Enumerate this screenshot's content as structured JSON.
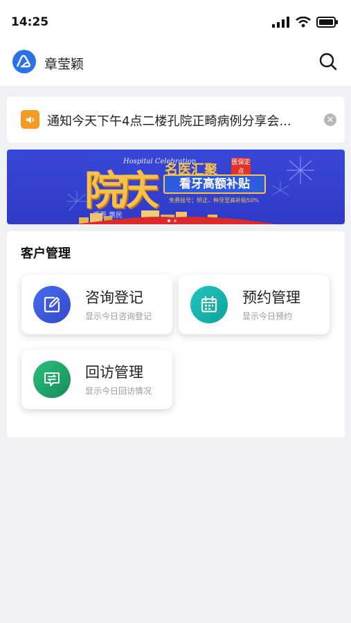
{
  "status_bar": {
    "time": "14:25"
  },
  "header": {
    "user_name": "章莹颖"
  },
  "notice": {
    "text": "通知今天下午4点二楼孔院正畸病例分享会..."
  },
  "banner": {
    "headline_chars": "院庆",
    "subtitle_en": "Hospital Celebration",
    "slogan": "感恩 惠民",
    "tag": "名医汇聚",
    "badge": "医保定点",
    "main_text": "看牙高额补贴",
    "small_text": "免费挂号；矫正、种牙至高补贴50%",
    "dots_total": 2,
    "dots_active": 0
  },
  "customer_management": {
    "title": "客户管理",
    "cards": [
      {
        "title": "咨询登记",
        "subtitle": "显示今日咨询登记",
        "icon": "edit-icon",
        "color": "#3b5bdb"
      },
      {
        "title": "预约管理",
        "subtitle": "显示今日预约",
        "icon": "calendar-icon",
        "color": "#17b3ad"
      },
      {
        "title": "回访管理",
        "subtitle": "显示今日回访情况",
        "icon": "exchange-icon",
        "color": "#1fa36c"
      }
    ]
  },
  "colors": {
    "brand": "#2a72e8",
    "notice": "#f59a23",
    "banner_bg": "#3947d6",
    "background": "#f0f1f5"
  }
}
